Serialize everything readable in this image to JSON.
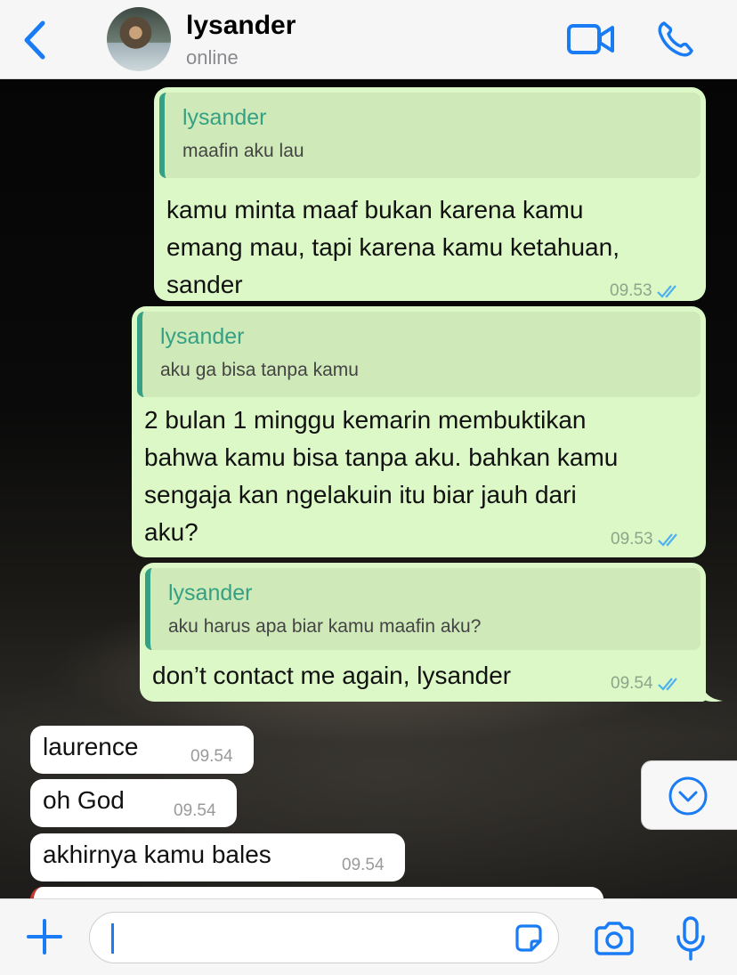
{
  "header": {
    "contact_name": "lysander",
    "status": "online",
    "icons": [
      "back-chevron-icon",
      "video-call-icon",
      "phone-icon"
    ]
  },
  "messages": {
    "m1": {
      "quote_name": "lysander",
      "quote_text": "maafin aku lau",
      "lines": [
        "kamu minta maaf bukan karena kamu",
        "emang mau, tapi karena kamu ketahuan,",
        "sander"
      ],
      "time": "09.53"
    },
    "m2": {
      "quote_name": "lysander",
      "quote_text": "aku ga bisa tanpa kamu",
      "lines": [
        "2 bulan 1 minggu kemarin membuktikan",
        "bahwa kamu bisa tanpa aku. bahkan kamu",
        "sengaja kan ngelakuin itu biar jauh dari",
        "aku?"
      ],
      "time": "09.53"
    },
    "m3": {
      "quote_name": "lysander",
      "quote_text": "aku harus apa biar kamu maafin aku?",
      "lines": [
        "don’t contact me again, lysander"
      ],
      "time": "09.54"
    },
    "in1": {
      "text": "laurence",
      "time": "09.54"
    },
    "in2": {
      "text": "oh God",
      "time": "09.54"
    },
    "in3": {
      "text": "akhirnya kamu bales",
      "time": "09.54"
    }
  },
  "colors": {
    "outgoing_bubble": "#dcf8c6",
    "quote_accent": "#35a083",
    "ios_blue": "#1a7cf5",
    "incoming_bubble": "#ffffff"
  },
  "composer": {
    "placeholder": "",
    "icons": [
      "plus-icon",
      "sticker-icon",
      "camera-icon",
      "microphone-icon"
    ]
  }
}
